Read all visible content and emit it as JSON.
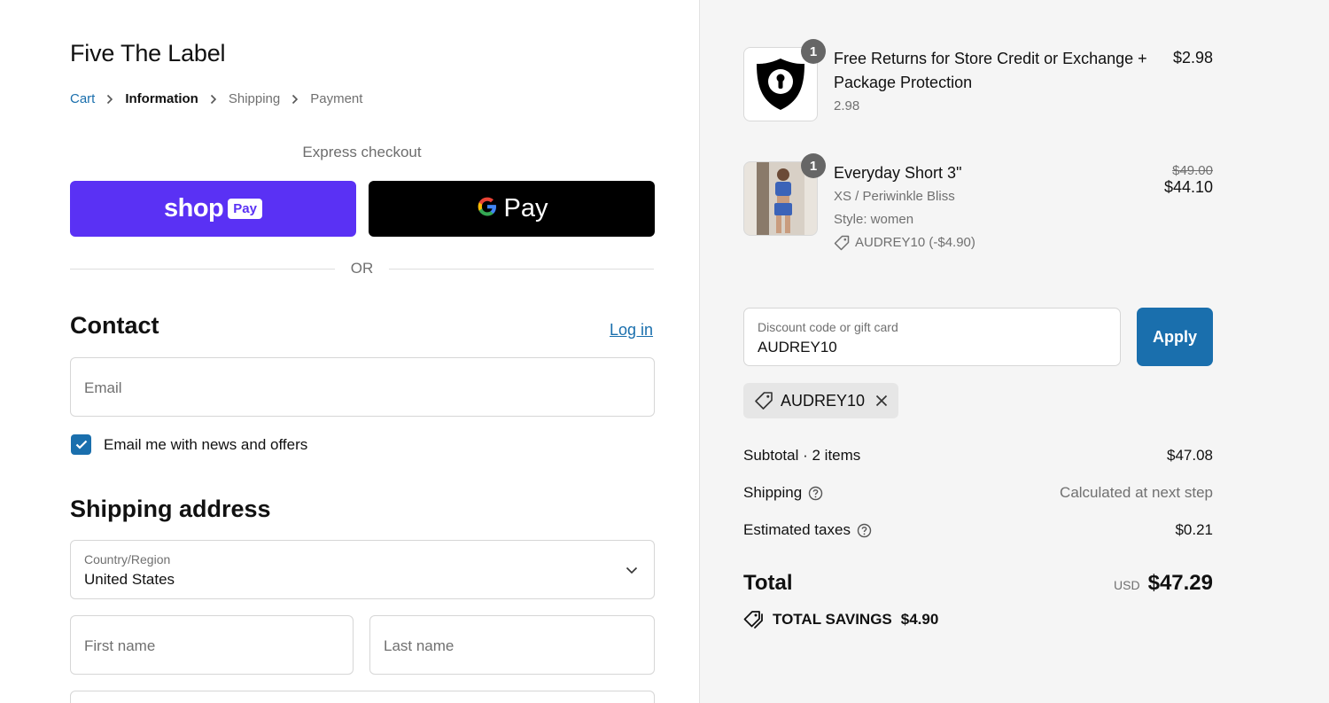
{
  "store": {
    "title": "Five The Label"
  },
  "breadcrumb": {
    "cart": "Cart",
    "information": "Information",
    "shipping": "Shipping",
    "payment": "Payment"
  },
  "express": {
    "label": "Express checkout",
    "shop_word": "shop",
    "shop_badge": "Pay",
    "gpay_word": "Pay",
    "or_text": "OR"
  },
  "contact": {
    "heading": "Contact",
    "login": "Log in",
    "email_placeholder": "Email",
    "newsletter_label": "Email me with news and offers",
    "newsletter_checked": true
  },
  "shipping_address": {
    "heading": "Shipping address",
    "country_label": "Country/Region",
    "country_value": "United States",
    "first_name_placeholder": "First name",
    "last_name_placeholder": "Last name"
  },
  "items": [
    {
      "qty": "1",
      "name": "Free Returns for Store Credit or Exchange + Package Protection",
      "sub": "2.98",
      "price": "$2.98",
      "icon": "shield-keyhole-icon"
    },
    {
      "qty": "1",
      "name": "Everyday Short 3\"",
      "variant": "XS / Periwinkle Bliss",
      "style": "Style: women",
      "discount": "AUDREY10 (-$4.90)",
      "original_price": "$49.00",
      "price": "$44.10"
    }
  ],
  "discount": {
    "label": "Discount code or gift card",
    "value": "AUDREY10",
    "apply": "Apply",
    "applied_code": "AUDREY10"
  },
  "summary": {
    "subtotal_label": "Subtotal · 2 items",
    "subtotal_value": "$47.08",
    "shipping_label": "Shipping",
    "shipping_value": "Calculated at next step",
    "taxes_label": "Estimated taxes",
    "taxes_value": "$0.21",
    "total_label": "Total",
    "currency": "USD",
    "total_value": "$47.29",
    "savings_label": "TOTAL SAVINGS",
    "savings_value": "$4.90"
  },
  "colors": {
    "accent": "#1a6fad",
    "shop_pay": "#5a31f4",
    "gpay": "#000000",
    "sidebar_bg": "#f5f5f5"
  }
}
